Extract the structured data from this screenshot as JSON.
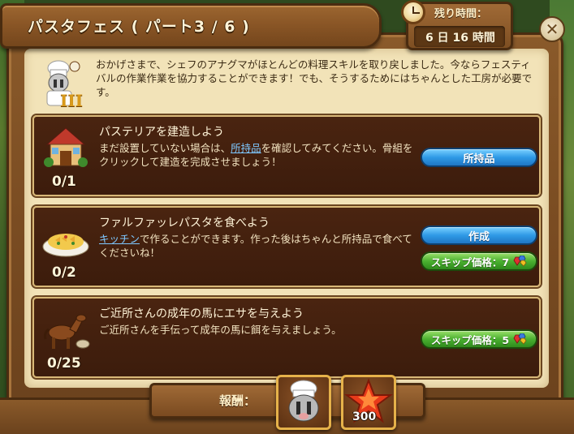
{
  "title": "パスタフェス ( パート3 / 6 )",
  "timer": {
    "label": "残り時間：",
    "value": "6 日 16 時間"
  },
  "intro": {
    "text": "おかげさまで、シェフのアナグマがほとんどの料理スキルを取り戻しました。今ならフェスティバルの作業作業を協力することができます！でも、そうするためにはちゃんとした工房が必要です。",
    "chef_rank": "III"
  },
  "tasks": [
    {
      "title": "パステリアを建造しよう",
      "desc_pre": "まだ設置していない場合は、",
      "desc_link": "所持品",
      "desc_post": "を確認してみてください。骨組をクリックして建造を完成させましょう！",
      "progress": "0/1",
      "button_label": "所持品"
    },
    {
      "title": "ファルファッレパスタを食べよう",
      "desc_pre": "",
      "desc_link": "キッチン",
      "desc_post": "で作ることができます。作った後はちゃんと所持品で食べてくださいね！",
      "progress": "0/2",
      "button_label": "作成",
      "skip_label": "スキップ価格：7"
    },
    {
      "title": "ご近所さんの成年の馬にエサを与えよう",
      "desc_pre": "ご近所さんを手伝って成年の馬に餌を与えましょう。",
      "desc_link": "",
      "desc_post": "",
      "progress": "0/25",
      "skip_label": "スキップ価格：5"
    }
  ],
  "reward": {
    "label": "報酬：",
    "xp_amount": "300"
  },
  "colors": {
    "parchment": "#f2e3b8",
    "card_bg": "#3c1c0c",
    "button_blue": "#2f9ae6",
    "button_green": "#4ab030"
  }
}
